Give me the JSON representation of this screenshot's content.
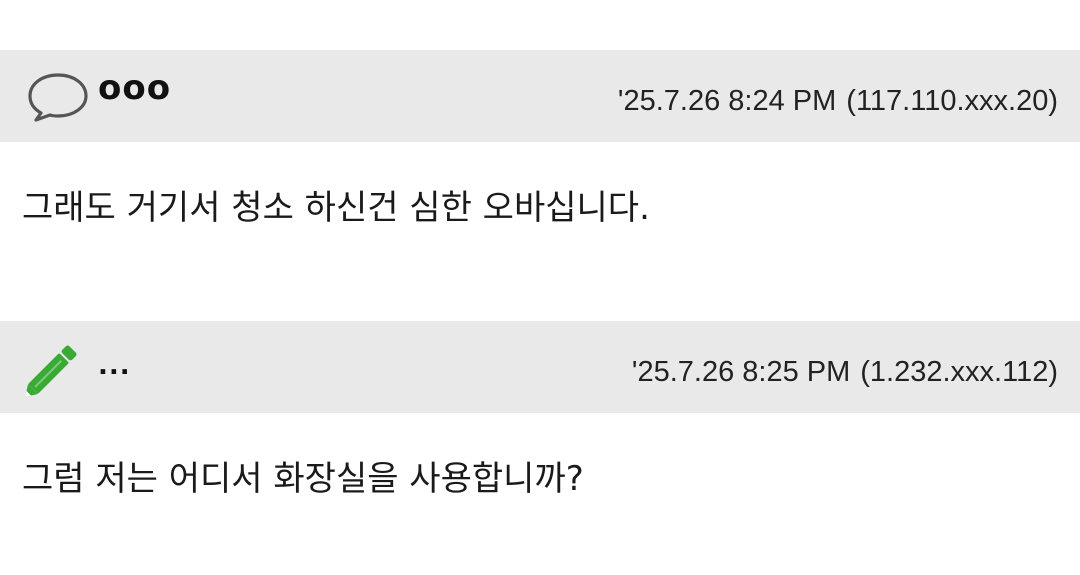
{
  "comments": [
    {
      "icon": "speech-bubble-icon",
      "author": "ooo",
      "timestamp": "'25.7.26 8:24 PM",
      "ip": "(117.110.xxx.20)",
      "text": "그래도 거기서 청소 하신건 심한 오바십니다."
    },
    {
      "icon": "pencil-icon",
      "icon_color": "#3aaa35",
      "author": "...",
      "timestamp": "'25.7.26 8:25 PM",
      "ip": "(1.232.xxx.112)",
      "text": "그럼 저는 어디서 화장실을 사용합니까?"
    }
  ],
  "colors": {
    "header_background": "#e9e9e9",
    "page_background": "#ffffff"
  }
}
